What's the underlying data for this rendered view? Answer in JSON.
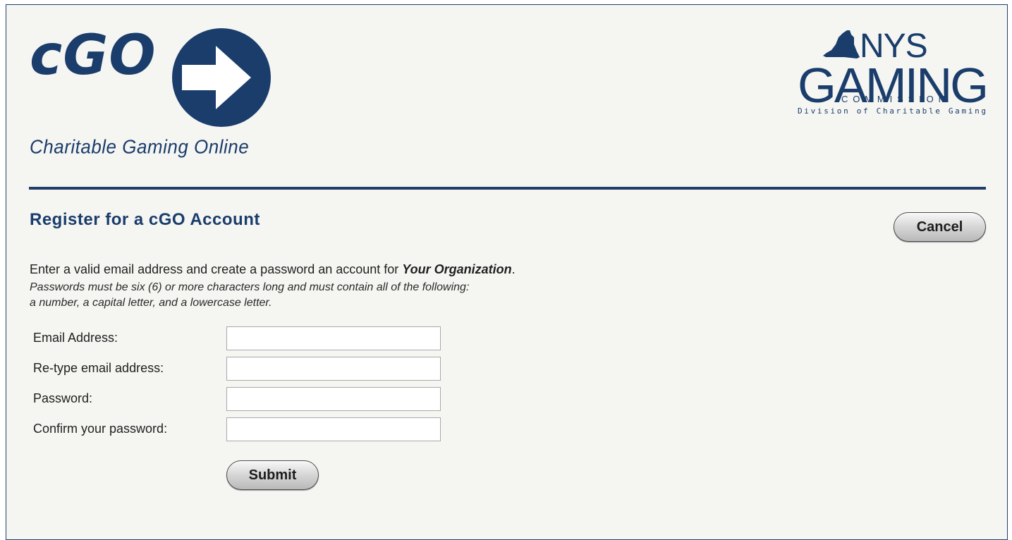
{
  "header": {
    "logo_text": "cGO",
    "tagline": "Charitable Gaming Online",
    "nys_logo": {
      "line1": "NYS",
      "line2": "GAMING",
      "line3": "COMMISSION",
      "line4": "Division of Charitable Gaming"
    }
  },
  "page": {
    "title": "Register for a cGO Account",
    "cancel_label": "Cancel",
    "intro_text": "Enter a valid email address and create a password an account for ",
    "intro_org": "Your Organization",
    "intro_end": ".",
    "rules_line1": "Passwords must be six (6) or more characters long and must contain all of the following:",
    "rules_line2": "a number, a capital letter, and a lowercase letter."
  },
  "form": {
    "fields": [
      {
        "label": "Email Address:",
        "value": ""
      },
      {
        "label": "Re-type email address:",
        "value": ""
      },
      {
        "label": "Password:",
        "value": ""
      },
      {
        "label": "Confirm your password:",
        "value": ""
      }
    ],
    "submit_label": "Submit"
  },
  "colors": {
    "brand_navy": "#1a3d6b",
    "background": "#f5f5f2"
  }
}
